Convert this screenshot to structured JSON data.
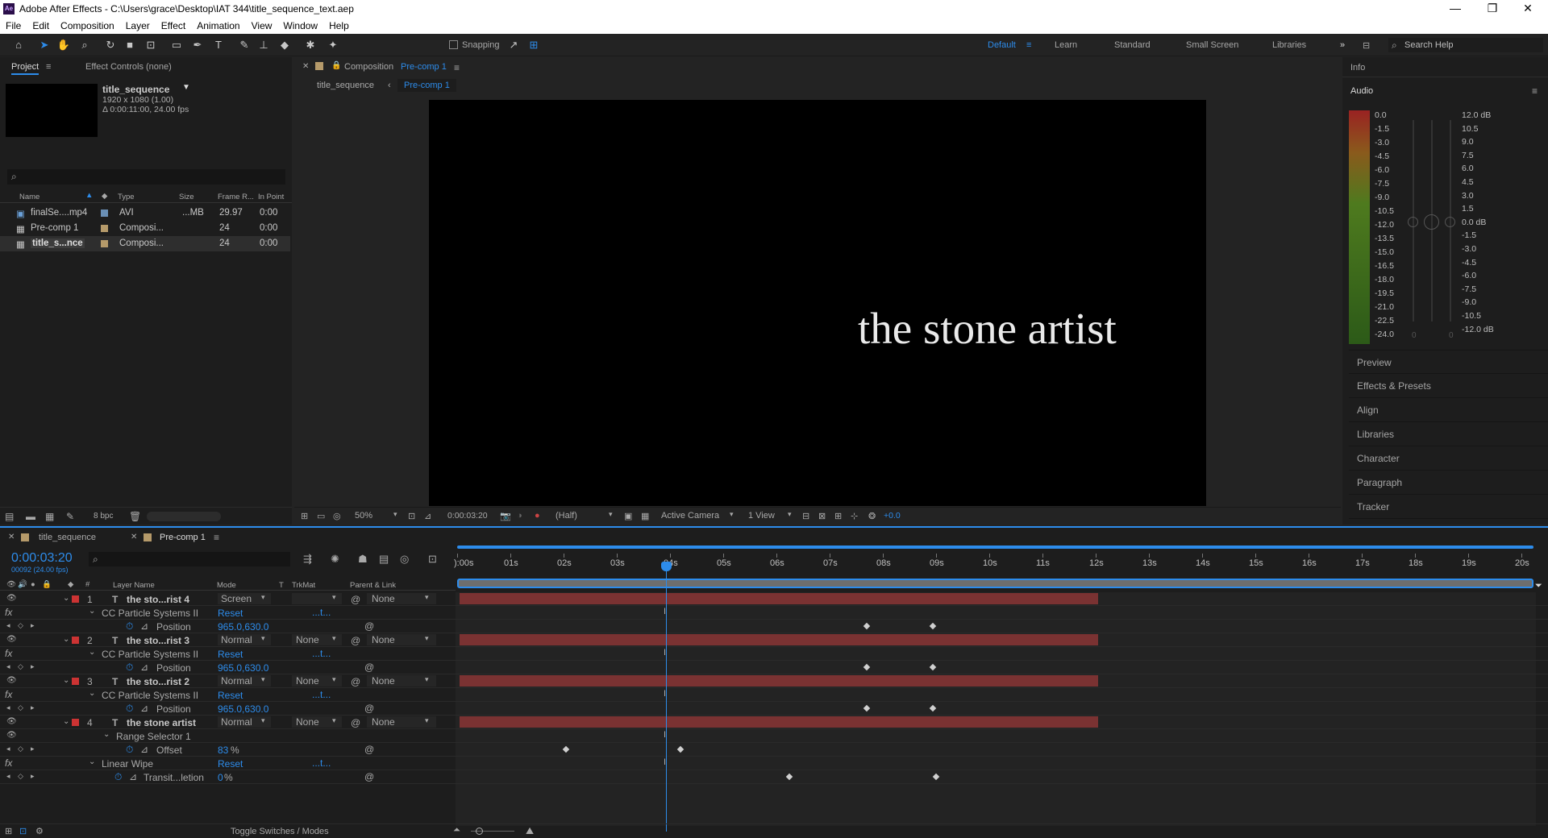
{
  "app": {
    "title": "Adobe After Effects - C:\\Users\\grace\\Desktop\\IAT 344\\title_sequence_text.aep",
    "logo": "Ae"
  },
  "window_controls": [
    "—",
    "❐",
    "✕"
  ],
  "menu": [
    "File",
    "Edit",
    "Composition",
    "Layer",
    "Effect",
    "Animation",
    "View",
    "Window",
    "Help"
  ],
  "toolbar": {
    "snapping_label": "Snapping",
    "workspaces": [
      "Default",
      "Learn",
      "Standard",
      "Small Screen",
      "Libraries"
    ],
    "active_workspace": "Default",
    "search_placeholder": "Search Help"
  },
  "project_panel": {
    "tab_project": "Project",
    "tab_effect_controls": "Effect Controls (none)",
    "selected_name": "title_sequence",
    "selected_dims": "1920 x 1080 (1.00)",
    "selected_duration": "Δ 0:00:11:00, 24.00 fps",
    "search_placeholder": "",
    "columns": [
      "Name",
      "Type",
      "Size",
      "Frame R...",
      "In Point"
    ],
    "items": [
      {
        "name": "finalSe....mp4",
        "type": "AVI",
        "size": "...MB",
        "fps": "29.97",
        "in": "0:00",
        "color": "#6a8fb5"
      },
      {
        "name": "Pre-comp 1",
        "type": "Composi...",
        "size": "",
        "fps": "24",
        "in": "0:00",
        "color": "#b59a6a"
      },
      {
        "name": "title_s...nce",
        "type": "Composi...",
        "size": "",
        "fps": "24",
        "in": "0:00",
        "color": "#b59a6a"
      }
    ],
    "bpc": "8 bpc"
  },
  "composition_panel": {
    "header": "Composition",
    "comp_name": "Pre-comp 1",
    "crumb_parent": "title_sequence",
    "crumb_current": "Pre-comp 1",
    "canvas_text": "the stone artist",
    "zoom": "50%",
    "timecode": "0:00:03:20",
    "resolution": "(Half)",
    "camera": "Active Camera",
    "views": "1 View",
    "exposure": "+0.0"
  },
  "right_panel": {
    "info": "Info",
    "audio": "Audio",
    "left_scale": [
      "0.0",
      "-1.5",
      "-3.0",
      "-4.5",
      "-6.0",
      "-7.5",
      "-9.0",
      "-10.5",
      "-12.0",
      "-13.5",
      "-15.0",
      "-16.5",
      "-18.0",
      "-19.5",
      "-21.0",
      "-22.5",
      "-24.0"
    ],
    "right_scale": [
      "12.0 dB",
      "10.5",
      "9.0",
      "7.5",
      "6.0",
      "4.5",
      "3.0",
      "1.5",
      "0.0 dB",
      "-1.5",
      "-3.0",
      "-4.5",
      "-6.0",
      "-7.5",
      "-9.0",
      "-10.5",
      "-12.0 dB"
    ],
    "slider_zero_a": "0",
    "slider_zero_b": "0",
    "panels": [
      "Preview",
      "Effects & Presets",
      "Align",
      "Libraries",
      "Character",
      "Paragraph",
      "Tracker"
    ]
  },
  "timeline": {
    "tabs": [
      "title_sequence",
      "Pre-comp 1"
    ],
    "timecode": "0:00:03:20",
    "frame_info": "00092 (24.00 fps)",
    "search_placeholder": "",
    "col_layer_name": "Layer Name",
    "col_mode": "Mode",
    "col_t": "T",
    "col_trkmat": "TrkMat",
    "col_parent": "Parent & Link",
    "ticks": [
      "):00s",
      "01s",
      "02s",
      "03s",
      "04s",
      "05s",
      "06s",
      "07s",
      "08s",
      "09s",
      "10s",
      "11s",
      "12s",
      "13s",
      "14s",
      "15s",
      "16s",
      "17s",
      "18s",
      "19s",
      "20s"
    ],
    "layers": [
      {
        "num": "1",
        "name": "the sto...rist 4",
        "mode": "Screen",
        "trk": "",
        "parent": "None",
        "effect": "CC Particle Systems II",
        "reset": "Reset",
        "prop": "Position",
        "val": "965.0,630.0"
      },
      {
        "num": "2",
        "name": "the sto...rist 3",
        "mode": "Normal",
        "trk": "None",
        "parent": "None",
        "effect": "CC Particle Systems II",
        "reset": "Reset",
        "prop": "Position",
        "val": "965.0,630.0"
      },
      {
        "num": "3",
        "name": "the sto...rist 2",
        "mode": "Normal",
        "trk": "None",
        "parent": "None",
        "effect": "CC Particle Systems II",
        "reset": "Reset",
        "prop": "Position",
        "val": "965.0,630.0"
      },
      {
        "num": "4",
        "name": "the stone artist",
        "mode": "Normal",
        "trk": "None",
        "parent": "None"
      }
    ],
    "range_selector": "Range Selector 1",
    "offset_label": "Offset",
    "offset_value": "83",
    "offset_unit": "%",
    "linear_wipe": "Linear Wipe",
    "wipe_reset": "Reset",
    "transition_label": "Transit...letion",
    "transition_value": "0",
    "transition_unit": "%",
    "dots": "...t...",
    "toggle_label": "Toggle Switches / Modes"
  }
}
